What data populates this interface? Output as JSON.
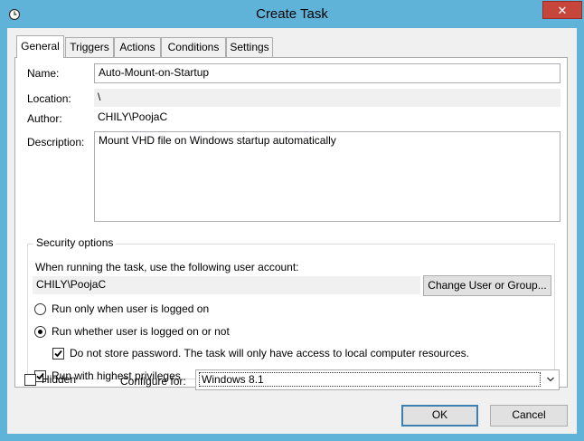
{
  "window": {
    "title": "Create Task",
    "close_glyph": "✕"
  },
  "tabs": [
    {
      "label": "General",
      "active": true
    },
    {
      "label": "Triggers"
    },
    {
      "label": "Actions"
    },
    {
      "label": "Conditions"
    },
    {
      "label": "Settings"
    }
  ],
  "general": {
    "name_label": "Name:",
    "name_value": "Auto-Mount-on-Startup",
    "location_label": "Location:",
    "location_value": "\\",
    "author_label": "Author:",
    "author_value": "CHILY\\PoojaC",
    "description_label": "Description:",
    "description_value": "Mount VHD file on Windows startup automatically"
  },
  "security": {
    "group_title": "Security options",
    "prompt": "When running the task, use the following user account:",
    "user_account": "CHILY\\PoojaC",
    "change_user_button": "Change User or Group...",
    "radio_logged_on": "Run only when user is logged on",
    "radio_whether": "Run whether user is logged on or not",
    "selected_radio": "whether",
    "no_store_password": "Do not store password.  The task will only have access to local computer resources.",
    "no_store_password_checked": true,
    "highest_privileges": "Run with highest privileges",
    "highest_privileges_checked": true
  },
  "footer": {
    "hidden_label": "Hidden",
    "hidden_checked": false,
    "configure_label": "Configure for:",
    "configure_value": "Windows 8.1",
    "ok_button": "OK",
    "cancel_button": "Cancel"
  },
  "colors": {
    "frame": "#5fb3d9",
    "close_button": "#c7463b",
    "default_button_border": "#3c7fb1"
  }
}
